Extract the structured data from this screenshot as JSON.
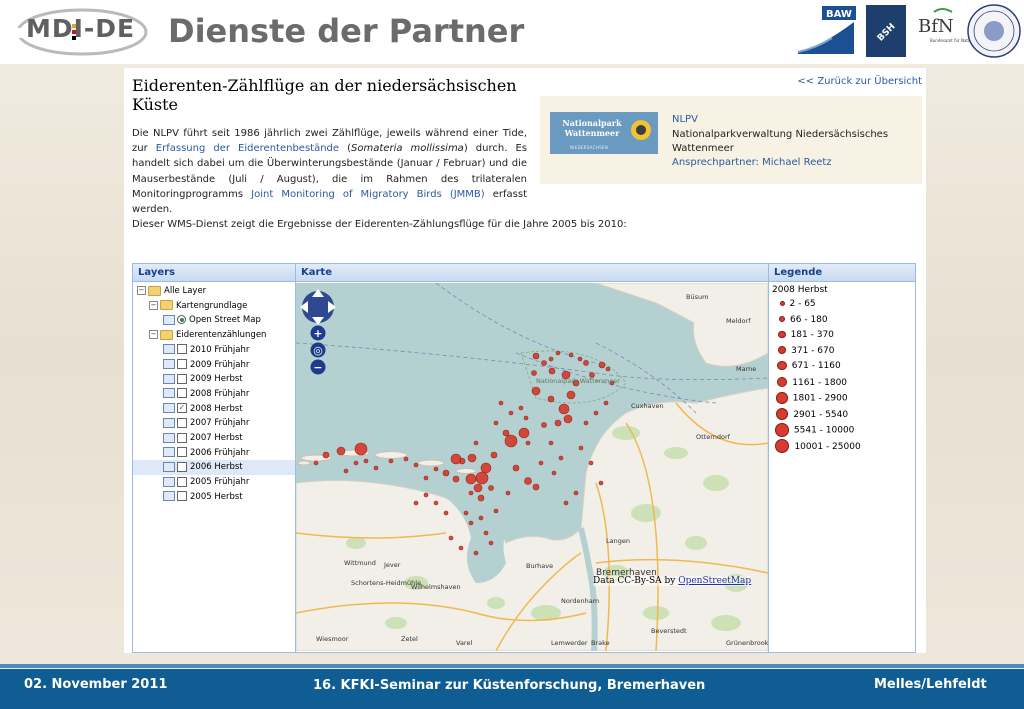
{
  "header": {
    "logo_text": "MDI-DE",
    "title": "Dienste der Partner",
    "partner_logo_text": {
      "baw": "BAW",
      "bsh": "BSH",
      "bfn": "BfN",
      "bfn_sub": "Bundesamt für Naturschutz"
    }
  },
  "page": {
    "heading": "Eiderenten-Zählflüge an der niedersächsischen Küste",
    "back_link": "<< Zurück zur Übersicht",
    "intro_parts": [
      "Die NLPV führt seit 1986 jährlich zwei Zählflüge, jeweils während einer Tide, zur ",
      "Erfassung der Eiderentenbestände",
      " (",
      "Somateria mollissima",
      ") durch. Es handelt sich dabei um die Überwinterungsbestände (Januar / Februar) und die Mauserbestände (Juli / August), die im Rahmen des trilateralen Monitoringprogramms ",
      "Joint Monitoring of Migratory Birds (JMMB)",
      " erfasst werden."
    ],
    "intro2": "Dieser WMS-Dienst zeigt die Ergebnisse der Eiderenten-Zählungsflüge für die Jahre 2005 bis 2010:"
  },
  "partner": {
    "logo_text": "Nationalpark Wattenmeer",
    "logo_sub": "NIEDERSACHSEN",
    "short": "NLPV",
    "name": "Nationalparkverwaltung Niedersächsisches Wattenmeer",
    "contact": "Ansprechpartner: Michael Reetz"
  },
  "app": {
    "panels": {
      "layers": "Layers",
      "map": "Karte",
      "legend": "Legende"
    },
    "tree": [
      {
        "label": "Alle Layer",
        "type": "folder",
        "level": 0
      },
      {
        "label": "Kartengrundlage",
        "type": "folder",
        "level": 1
      },
      {
        "label": "Open Street Map",
        "type": "radio",
        "checked": true,
        "level": 2
      },
      {
        "label": "Eiderentenzählungen",
        "type": "folder",
        "level": 1
      },
      {
        "label": "2010 Frühjahr",
        "type": "check",
        "checked": false,
        "level": 2
      },
      {
        "label": "2009 Frühjahr",
        "type": "check",
        "checked": false,
        "level": 2
      },
      {
        "label": "2009 Herbst",
        "type": "check",
        "checked": false,
        "level": 2
      },
      {
        "label": "2008 Frühjahr",
        "type": "check",
        "checked": false,
        "level": 2
      },
      {
        "label": "2008 Herbst",
        "type": "check",
        "checked": true,
        "level": 2
      },
      {
        "label": "2007 Frühjahr",
        "type": "check",
        "checked": false,
        "level": 2
      },
      {
        "label": "2007 Herbst",
        "type": "check",
        "checked": false,
        "level": 2
      },
      {
        "label": "2006 Frühjahr",
        "type": "check",
        "checked": false,
        "level": 2
      },
      {
        "label": "2006 Herbst",
        "type": "check",
        "checked": false,
        "level": 2,
        "selected": true
      },
      {
        "label": "2005 Frühjahr",
        "type": "check",
        "checked": false,
        "level": 2
      },
      {
        "label": "2005 Herbst",
        "type": "check",
        "checked": false,
        "level": 2
      }
    ],
    "legend": {
      "title": "2008 Herbst",
      "classes": [
        "2 - 65",
        "66 - 180",
        "181 - 370",
        "371 - 670",
        "671 - 1160",
        "1161 - 1800",
        "1801 - 2900",
        "2901 - 5540",
        "5541 - 10000",
        "10001 - 25000"
      ]
    },
    "map": {
      "places": [
        "Büsum",
        "Meldorf",
        "Marne",
        "Cuxhaven",
        "Otterndorf",
        "Langen",
        "Bremerhaven",
        "Burhave",
        "Nordenham",
        "Beverstedt",
        "Grünenbrook",
        "Jever",
        "Wittmund",
        "Schortens-Heidmühle",
        "Wilhelmshaven",
        "Zetel",
        "Varel",
        "Wiesmoor",
        "Brake",
        "Lemwerder",
        "Nationalpark Wattenmeer"
      ],
      "attribution_text": "Data CC-By-SA by ",
      "attribution_link": "OpenStreetMap"
    },
    "point_colors": {
      "fill": "#d63c2f",
      "stroke": "#8a1a12"
    }
  },
  "footer": {
    "date": "02. November 2011",
    "event": "16. KFKI-Seminar zur Küstenforschung, Bremerhaven",
    "author": "Melles/Lehfeldt"
  }
}
